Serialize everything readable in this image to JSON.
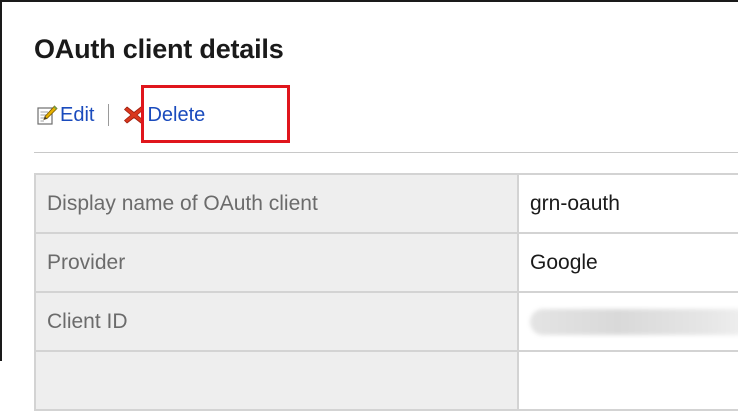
{
  "page": {
    "title": "OAuth client details"
  },
  "toolbar": {
    "edit_label": "Edit",
    "edit_icon": "edit-pencil-icon",
    "delete_label": "Delete",
    "delete_icon": "red-x-icon",
    "highlight_color": "#e0161c"
  },
  "details": {
    "rows": [
      {
        "label": "Display name of OAuth client",
        "value": "grn-oauth"
      },
      {
        "label": "Provider",
        "value": "Google"
      },
      {
        "label": "Client ID",
        "value": ""
      },
      {
        "label": "",
        "value": ""
      }
    ]
  },
  "colors": {
    "link": "#1a4bbd",
    "label_bg": "#eeeeee",
    "border": "#d3d3d3"
  }
}
